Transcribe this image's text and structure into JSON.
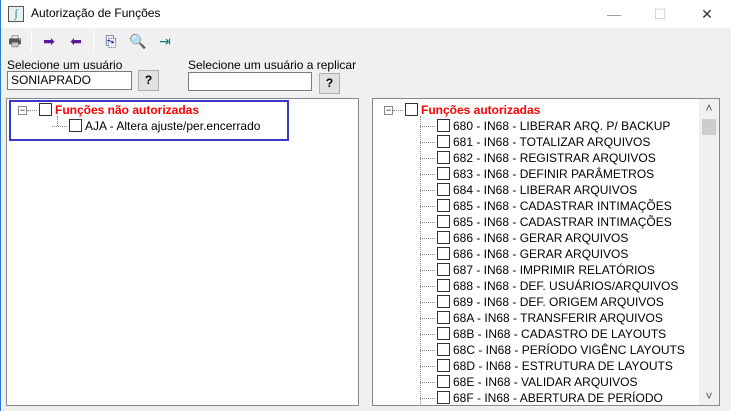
{
  "window": {
    "title": "Autorização de Funções",
    "minimize": "—",
    "maximize": "☐",
    "close": "✕",
    "app_icon": "∫"
  },
  "toolbar": {
    "print": "🖶",
    "move_right": "➡",
    "move_left": "⬅",
    "copy": "⎘",
    "search": "🔍",
    "exit": "⇥"
  },
  "user": {
    "label": "Selecione um usuário",
    "value": "SONIAPRADO",
    "help": "?"
  },
  "replicate": {
    "label": "Selecione um usuário a replicar",
    "value": "",
    "help": "?"
  },
  "left_tree": {
    "root": "Funções não autorizadas",
    "items": [
      "AJA - Altera ajuste/per.encerrado"
    ]
  },
  "right_tree": {
    "root": "Funções autorizadas",
    "items": [
      "680 - IN68 - LIBERAR ARQ. P/ BACKUP",
      "681 - IN68 - TOTALIZAR ARQUIVOS",
      "682 - IN68 - REGISTRAR ARQUIVOS",
      "683 - IN68 - DEFINIR PARÂMETROS",
      "684 - IN68 - LIBERAR ARQUIVOS",
      "685 - IN68 - CADASTRAR INTIMAÇÕES",
      "685 - IN68 - CADASTRAR INTIMAÇÕES",
      "686 - IN68 - GERAR ARQUIVOS",
      "686 - IN68 - GERAR ARQUIVOS",
      "687 - IN68 - IMPRIMIR RELATÓRIOS",
      "688 - IN68 - DEF. USUÁRIOS/ARQUIVOS",
      "689 - IN68 - DEF. ORIGEM ARQUIVOS",
      "68A - IN68 - TRANSFERIR ARQUIVOS",
      "68B - IN68 - CADASTRO DE LAYOUTS",
      "68C - IN68 - PERÍODO VIGÊNC LAYOUTS",
      "68D - IN68 - ESTRUTURA DE LAYOUTS",
      "68E - IN68 - VALIDAR ARQUIVOS",
      "68F - IN68 - ABERTURA DE PERÍODO"
    ]
  },
  "scrollbar": {
    "up": "˄",
    "down": "˅"
  }
}
